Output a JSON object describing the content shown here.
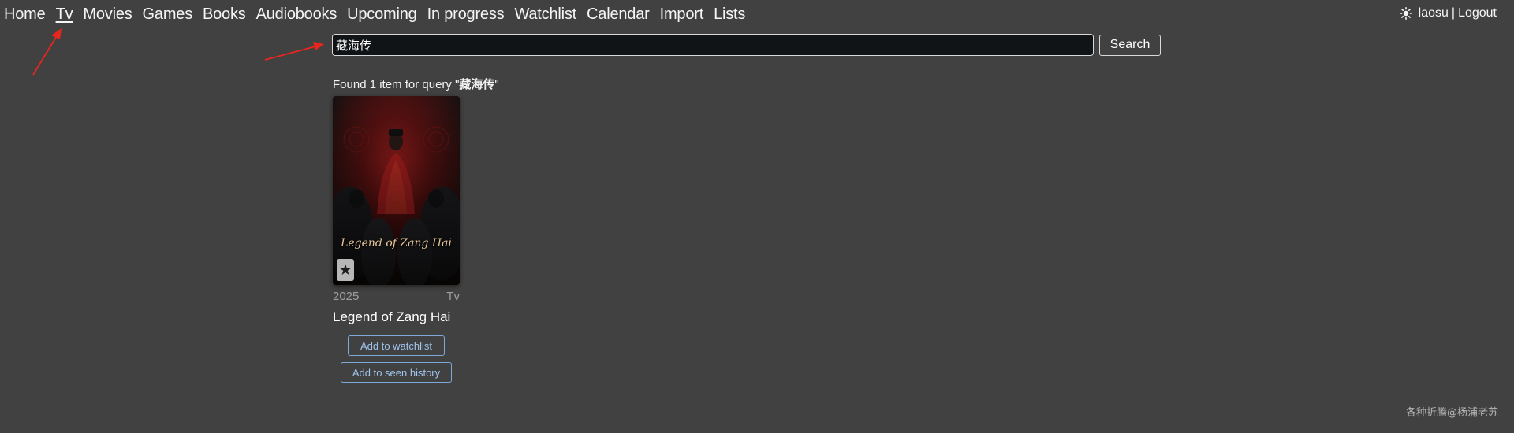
{
  "nav": {
    "items": [
      {
        "label": "Home",
        "active": false
      },
      {
        "label": "Tv",
        "active": true
      },
      {
        "label": "Movies",
        "active": false
      },
      {
        "label": "Games",
        "active": false
      },
      {
        "label": "Books",
        "active": false
      },
      {
        "label": "Audiobooks",
        "active": false
      },
      {
        "label": "Upcoming",
        "active": false
      },
      {
        "label": "In progress",
        "active": false
      },
      {
        "label": "Watchlist",
        "active": false
      },
      {
        "label": "Calendar",
        "active": false
      },
      {
        "label": "Import",
        "active": false
      },
      {
        "label": "Lists",
        "active": false
      }
    ]
  },
  "user": {
    "theme_icon": "sun-icon",
    "username": "laosu",
    "separator": "|",
    "logout_label": "Logout"
  },
  "search": {
    "value": "藏海传",
    "button_label": "Search"
  },
  "results": {
    "prefix": "Found 1 item for query \"",
    "query": "藏海传",
    "suffix": "\""
  },
  "items": [
    {
      "poster_text": "Legend of Zang Hai",
      "star_icon": "★",
      "year": "2025",
      "type": "Tv",
      "title": "Legend of Zang Hai",
      "watchlist_label": "Add to watchlist",
      "seen_label": "Add to seen history"
    }
  ],
  "watermark": "各种折腾@杨浦老苏",
  "colors": {
    "background": "#414141",
    "search_bg": "#111417",
    "action_border": "#7fa9d9",
    "arrow": "#e8261e"
  }
}
